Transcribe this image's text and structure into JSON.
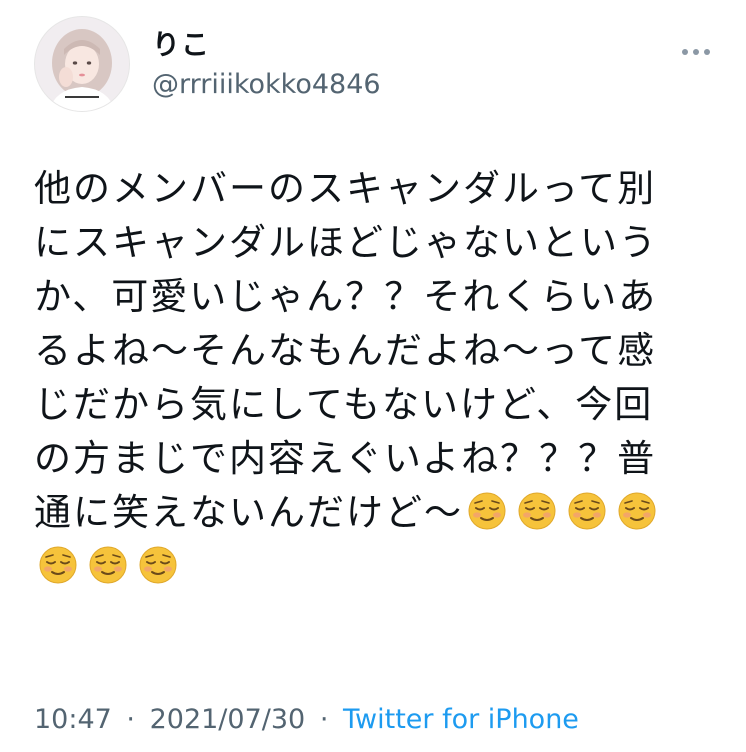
{
  "author": {
    "display_name": "りこ",
    "handle": "@rrriiikokko4846"
  },
  "tweet": {
    "lines": [
      "他のメンバーのスキャンダルって別",
      "にスキャンダルほどじゃないという",
      "か、可愛いじゃん？？それくらいあ",
      "るよね〜そんなもんだよね〜って感",
      "じだから気にしてもないけど、今回",
      "の方まじで内容えぐいよね？？？普",
      "通に笑えないんだけど〜"
    ],
    "emoji_name": "relieved-face-emoji"
  },
  "meta": {
    "time": "10:47",
    "separator": "·",
    "date": "2021/07/30",
    "source": "Twitter for iPhone"
  },
  "colors": {
    "text": "#0f1419",
    "secondary": "#536471",
    "link": "#1d9bf0",
    "emoji": "#f6c33b"
  }
}
